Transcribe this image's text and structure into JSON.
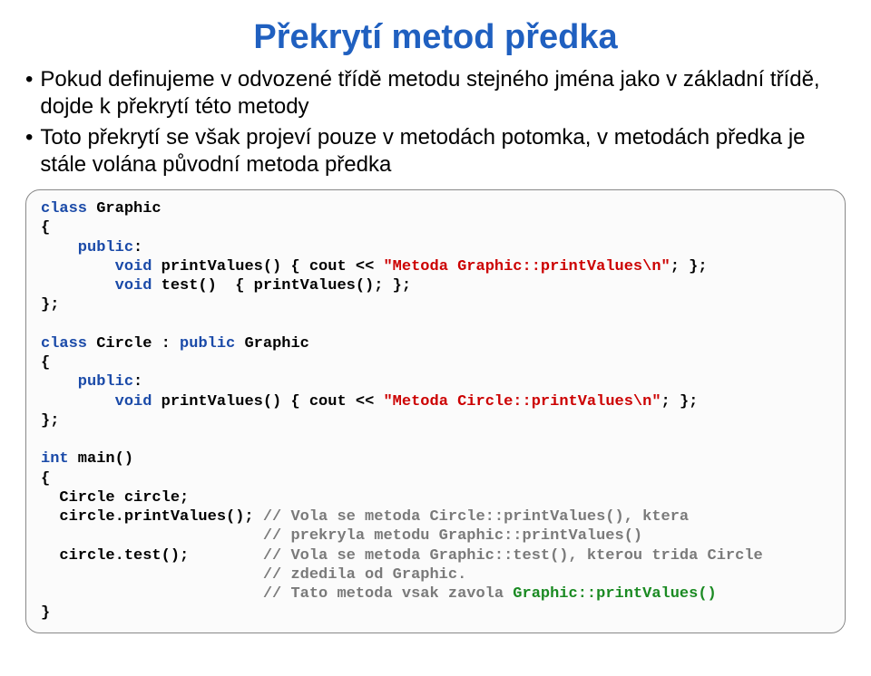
{
  "title": "Překrytí metod předka",
  "bullets": [
    "Pokud definujeme v odvozené třídě metodu stejného jména jako v základní třídě, dojde k překrytí této metody",
    "Toto překrytí se však projeví pouze v metodách potomka, v metodách předka je stále volána původní metoda předka"
  ],
  "code": {
    "l1_kw_class": "class",
    "l1_name": " Graphic",
    "l2": "{",
    "l3_kw": "    public",
    "l3_colon": ":",
    "l4a_kw": "        void",
    "l4a_fn": " printValues() { ",
    "l4a_cout_kw": "cout",
    "l4a_op": " << ",
    "l4a_str": "\"Metoda Graphic::printValues\\n\"",
    "l4a_end": "; };",
    "l5a_kw": "        void",
    "l5a_fn": " test()  { printValues(); };",
    "l6": "};",
    "blank": "",
    "l7_kw_class": "class",
    "l7_rest": " Circle : ",
    "l7_kw_public": "public",
    "l7_name": " Graphic",
    "l8": "{",
    "l9_kw": "    public",
    "l9_colon": ":",
    "l10_kw": "        void",
    "l10_fn": " printValues() { ",
    "l10_cout_kw": "cout",
    "l10_op": " << ",
    "l10_str": "\"Metoda Circle::printValues\\n\"",
    "l10_end": "; };",
    "l11": "};",
    "l12_kw_int": "int",
    "l12_main": " main()",
    "l13": "{",
    "l14": "  Circle circle;",
    "l15a": "  circle.printValues(); ",
    "l15b": "// Vola se metoda Circle::printValues(), ktera",
    "l16": "                        // prekryla metodu Graphic::printValues()",
    "l17a": "  circle.test();        ",
    "l17b": "// Vola se metoda Graphic::test(), kterou trida Circle",
    "l18": "                        // zdedila od Graphic.",
    "l19a": "                        // Tato metoda vsak zavola ",
    "l19b": "Graphic::printValues()",
    "l20": "}"
  }
}
